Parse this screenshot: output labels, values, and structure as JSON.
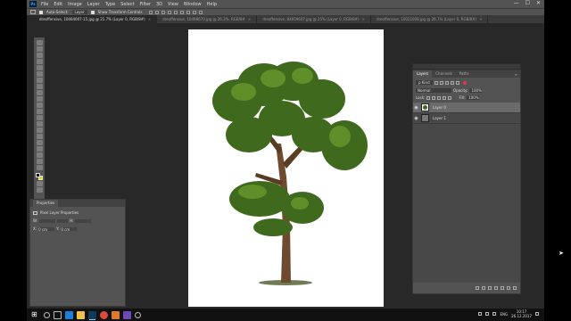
{
  "app": {
    "logo": "Ps",
    "menus": [
      "File",
      "Edit",
      "Image",
      "Layer",
      "Type",
      "Select",
      "Filter",
      "3D",
      "View",
      "Window",
      "Help"
    ],
    "window_controls": [
      "—",
      "☐",
      "✕"
    ]
  },
  "options_bar": {
    "auto_select_label": "Auto-Select:",
    "auto_select_value": "Layer",
    "show_transform_label": "Show Transform Controls"
  },
  "document_tabs": [
    {
      "label": "dreoffensive, 10464007-15.jpg @ 21.7% (Layer 0, RGB/8#)",
      "active": true
    },
    {
      "label": "dreoffensive, 10498670.jpg @ 26.3%, RGB/8#",
      "active": false
    },
    {
      "label": "dreoffensive, 84659607.jpg @ 25% (Layer 0, RGB/8#)",
      "active": false
    },
    {
      "label": "dreoffensive, 10021008.jpg @ 26.7% (Layer 0, RGB/8#)",
      "active": false
    }
  ],
  "properties_panel": {
    "tab_label": "Properties",
    "header": "Pixel Layer Properties",
    "w_label": "W:",
    "h_label": "H:",
    "x_label": "X:",
    "y_label": "Y:",
    "x_unit": "0 cm",
    "y_unit": "0 cm"
  },
  "layers_panel": {
    "tabs": [
      "Layers",
      "Channels",
      "Paths"
    ],
    "menu_icon": "≡",
    "kind_label": "ρ Kind",
    "blend_mode": "Normal",
    "opacity_label": "Opacity:",
    "opacity_value": "100%",
    "lock_label": "Lock:",
    "fill_label": "Fill:",
    "fill_value": "100%",
    "layers": [
      {
        "name": "Layer 0",
        "selected": true,
        "thumb": "tree"
      },
      {
        "name": "Layer 1",
        "selected": false,
        "thumb": "grey"
      }
    ]
  },
  "taskbar": {
    "clock_time": "10:17",
    "clock_date": "26.12.2017",
    "lang": "ENG"
  },
  "colors": {
    "app_bg": "#282828",
    "panel_bg": "#535353",
    "canvas_bg": "#ffffff",
    "tree_canopy": "#3f6a1e",
    "tree_trunk": "#6e4a2e"
  }
}
